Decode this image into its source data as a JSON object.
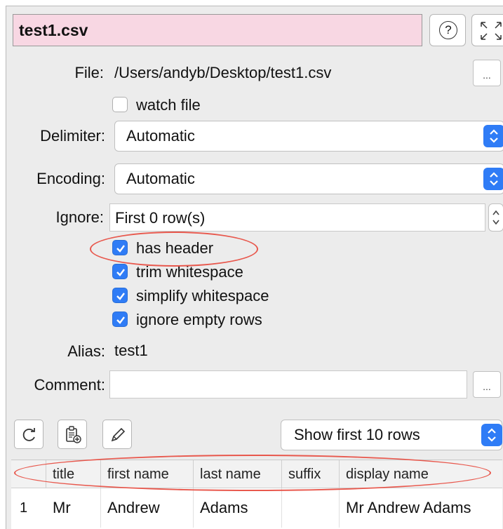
{
  "header": {
    "title": "test1.csv",
    "help_glyph": "?"
  },
  "file": {
    "label": "File:",
    "value": "/Users/andyb/Desktop/test1.csv",
    "browse_label": "...",
    "watch_label": "watch file",
    "watch_checked": false
  },
  "delimiter": {
    "label": "Delimiter:",
    "value": "Automatic"
  },
  "encoding": {
    "label": "Encoding:",
    "value": "Automatic"
  },
  "ignore": {
    "label": "Ignore:",
    "value": "First 0 row(s)"
  },
  "options": [
    {
      "label": "has header",
      "checked": true
    },
    {
      "label": "trim whitespace",
      "checked": true
    },
    {
      "label": "simplify whitespace",
      "checked": true
    },
    {
      "label": "ignore empty rows",
      "checked": true
    }
  ],
  "alias": {
    "label": "Alias:",
    "value": "test1"
  },
  "comment": {
    "label": "Comment:",
    "value": "",
    "browse_label": "..."
  },
  "toolbar": {
    "refresh_icon": "refresh-icon",
    "paste_icon": "clipboard-icon",
    "edit_icon": "pencil-icon",
    "rows_select": "Show first 10 rows"
  },
  "table": {
    "columns": [
      "title",
      "first name",
      "last name",
      "suffix",
      "display name"
    ],
    "rows": [
      {
        "num": "1",
        "cells": [
          "Mr",
          "Andrew",
          "Adams",
          "",
          "Mr Andrew Adams"
        ]
      }
    ]
  },
  "colors": {
    "title_bg": "#f8d7e3",
    "accent": "#2f7cf6",
    "annotation": "#e8584d"
  }
}
